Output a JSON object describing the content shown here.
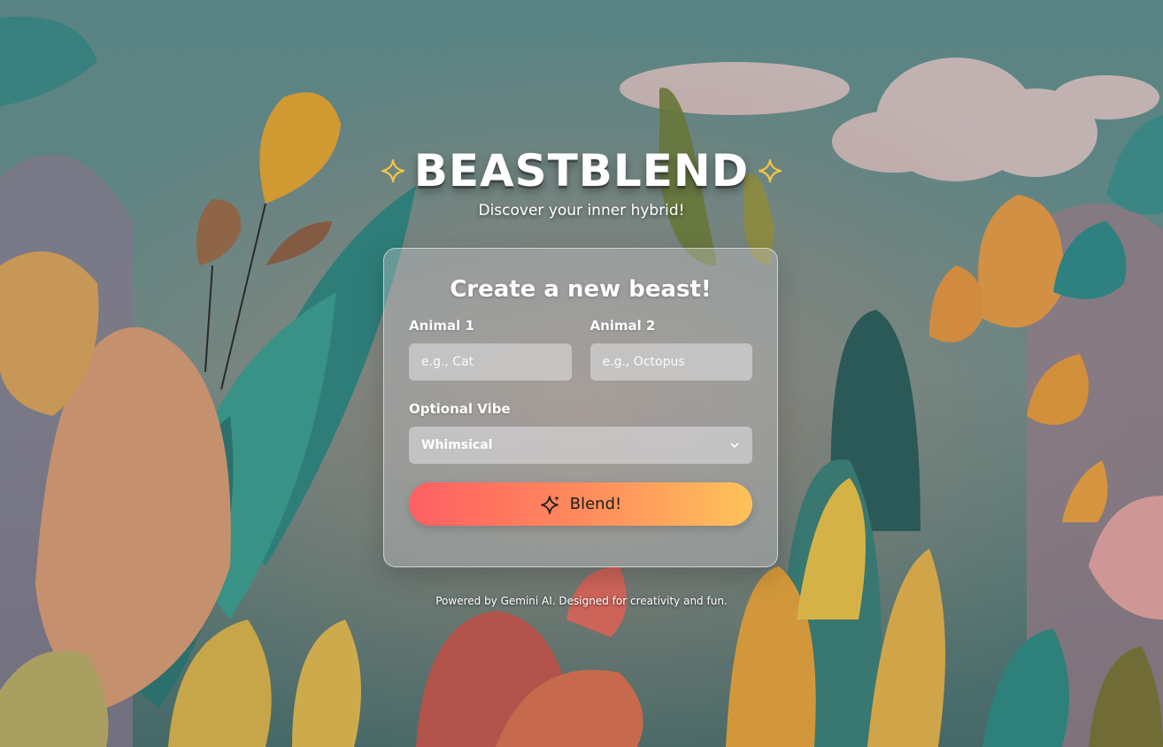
{
  "header": {
    "title": "BEASTBLEND",
    "tagline": "Discover your inner hybrid!",
    "left_icon": "sparkle-icon",
    "right_icon": "sparkle-icon"
  },
  "form": {
    "title": "Create a new beast!",
    "animal1": {
      "label": "Animal 1",
      "placeholder": "e.g., Cat",
      "value": ""
    },
    "animal2": {
      "label": "Animal 2",
      "placeholder": "e.g., Octopus",
      "value": ""
    },
    "vibe": {
      "label": "Optional Vibe",
      "selected": "Whimsical",
      "icon": "chevron-down-icon"
    },
    "submit": {
      "label": "Blend!",
      "icon": "sparkle-icon"
    }
  },
  "footer": {
    "text": "Powered by Gemini AI. Designed for creativity and fun."
  },
  "colors": {
    "sparkle": "#f5c542",
    "button_start": "#ff5f62",
    "button_end": "#ffc25a",
    "background_sky": "#5e8a8a"
  }
}
